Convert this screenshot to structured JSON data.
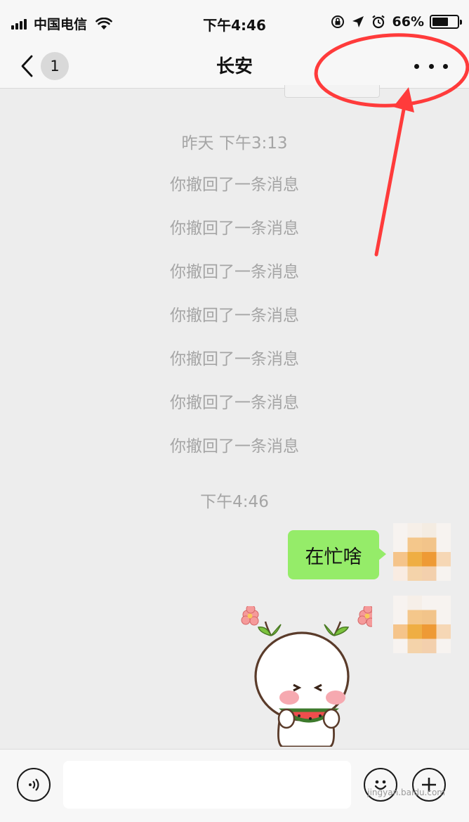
{
  "status_bar": {
    "carrier": "中国电信",
    "time": "下午4:46",
    "battery_percent": "66%",
    "battery_level": 0.66
  },
  "nav": {
    "unread_count": "1",
    "title": "长安"
  },
  "chat": {
    "timestamp_1": "昨天 下午3:13",
    "recalled_messages": [
      "你撤回了一条消息",
      "你撤回了一条消息",
      "你撤回了一条消息",
      "你撤回了一条消息",
      "你撤回了一条消息",
      "你撤回了一条消息",
      "你撤回了一条消息"
    ],
    "timestamp_2": "下午4:46",
    "sent_message": "在忙啥"
  },
  "input_bar": {
    "icons": [
      "voice-icon",
      "emoji-icon",
      "plus-icon"
    ]
  },
  "watermark": "jingyan.baidu.com",
  "colors": {
    "bubble_green": "#95ec69",
    "annotation_red": "#ff3b3b",
    "background": "#ededed"
  }
}
